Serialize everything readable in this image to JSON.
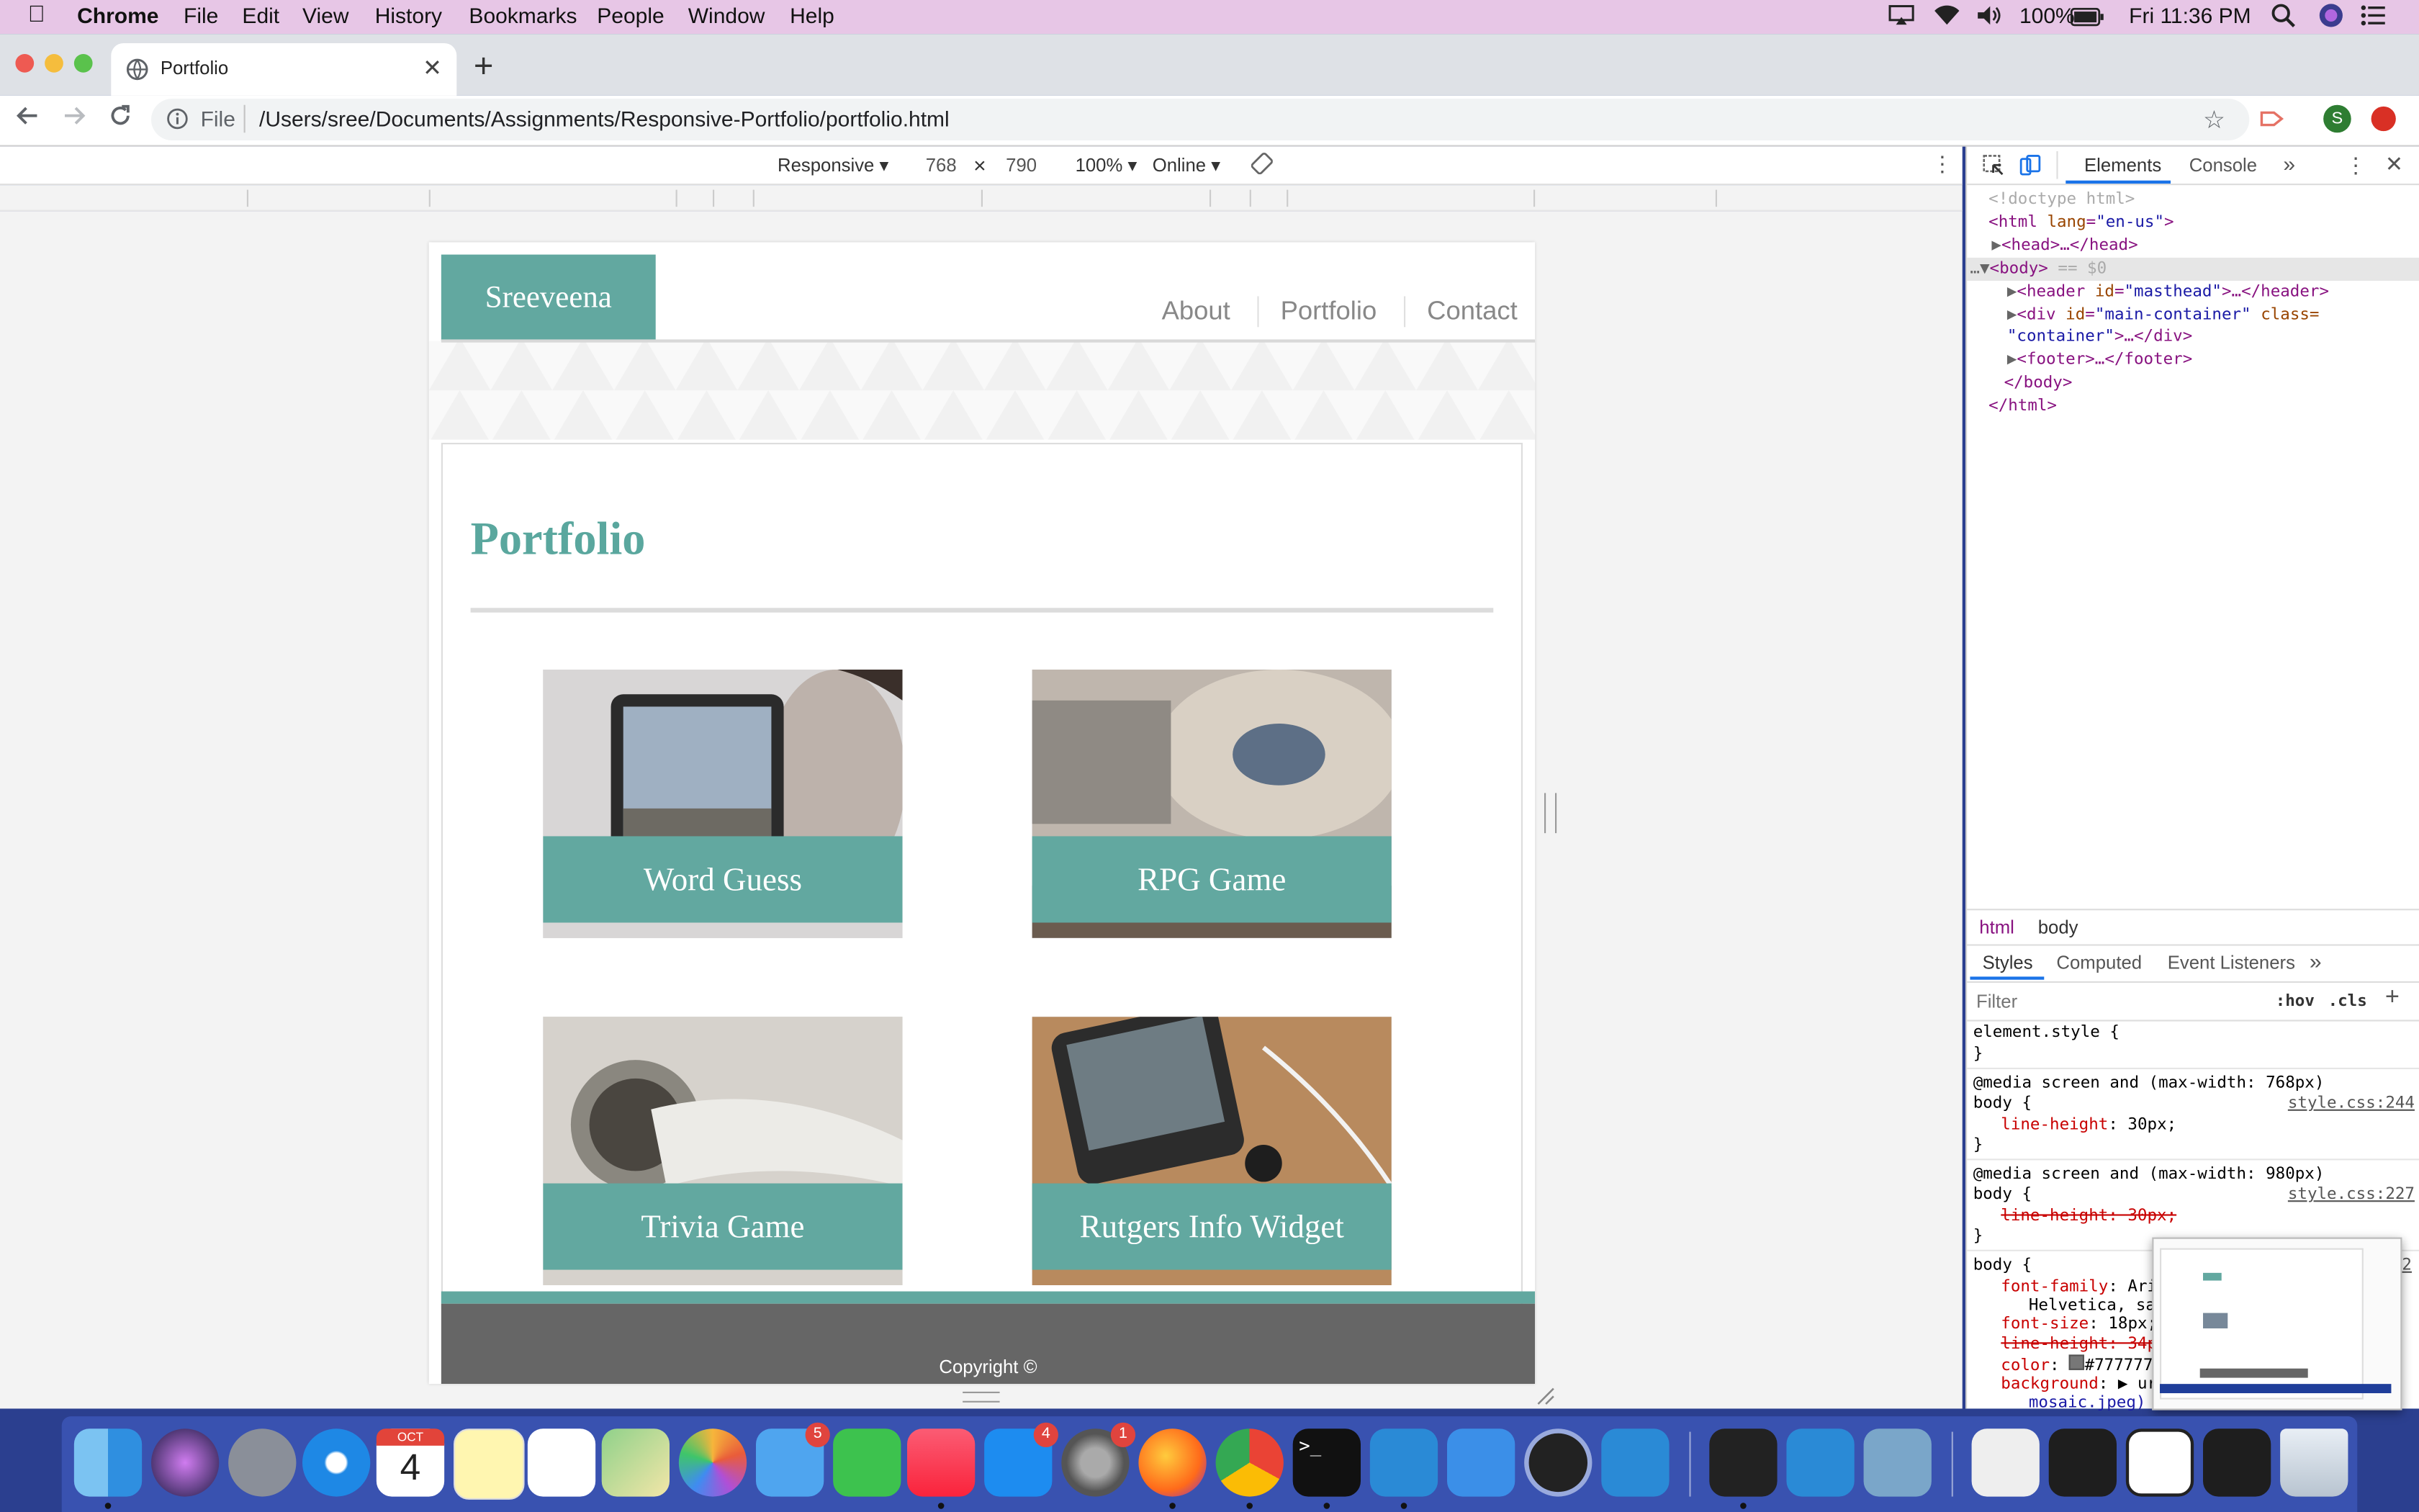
{
  "menubar": {
    "app": "Chrome",
    "items": [
      "File",
      "Edit",
      "View",
      "History",
      "Bookmarks",
      "People",
      "Window",
      "Help"
    ],
    "battery": "100%",
    "clock": "Fri 11:36 PM"
  },
  "browser": {
    "tab_title": "Portfolio",
    "url_prefix": "File",
    "url": "/Users/sree/Documents/Assignments/Responsive-Portfolio/portfolio.html",
    "profile_initial": "S"
  },
  "device_toolbar": {
    "mode": "Responsive ▾",
    "width": "768",
    "times": "×",
    "height": "790",
    "zoom": "100% ▾",
    "network": "Online ▾"
  },
  "site": {
    "brand": "Sreeveena",
    "nav": [
      "About",
      "Portfolio",
      "Contact"
    ],
    "heading": "Portfolio",
    "projects": [
      {
        "title": "Word Guess"
      },
      {
        "title": "RPG Game"
      },
      {
        "title": "Trivia Game"
      },
      {
        "title": "Rutgers Info Widget"
      }
    ],
    "footer": "Copyright ©"
  },
  "devtools": {
    "tabs": [
      "Elements",
      "Console"
    ],
    "more": "»",
    "dom": {
      "doctype": "<!doctype html>",
      "html_open_tag": "<html",
      "html_attr": "lang",
      "html_val": "\"en-us\"",
      "head": "<head>…</head>",
      "body_open": "<body>",
      "body_marker": "== $0",
      "header_tag": "<header",
      "header_attr": "id",
      "header_val": "\"masthead\"",
      "header_close": ">…</header>",
      "div_tag": "<div",
      "div_attr": "id",
      "div_val": "\"main-container\"",
      "div_class": "class=",
      "div_class_val": "\"container\"",
      "div_close": ">…</div>",
      "footer": "<footer>…</footer>",
      "body_close": "</body>",
      "html_close": "</html>"
    },
    "breadcrumbs": [
      "html",
      "body"
    ],
    "style_tabs": [
      "Styles",
      "Computed",
      "Event Listeners"
    ],
    "filter_placeholder": "Filter",
    "hov": ":hov",
    "cls": ".cls",
    "rules": {
      "element_style": "element.style {",
      "close": "}",
      "m1": "@media screen and (max-width: 768px)",
      "m1_sel": "body {",
      "m1_src": "style.css:244",
      "m1_prop": "line-height",
      "m1_val": "30px;",
      "m2": "@media screen and (max-width: 980px)",
      "m2_sel": "body {",
      "m2_src": "style.css:227",
      "m2_prop": "line-height: 30px;",
      "b_sel": "body {",
      "b_font_family": "font-family",
      "b_font_family_val": "Ari",
      "b_font_family_cont": "Helvetica, sa",
      "b_font_size": "font-size",
      "b_font_size_val": "18px;",
      "b_line_height": "line-height: 34p",
      "b_color": "color",
      "b_color_val": "#777777",
      "b_background": "background",
      "b_background_val": "url",
      "b_background_cont": "mosaic.jpeg)",
      "b_src_tail": "2"
    }
  },
  "dock": {
    "calendar_month": "OCT",
    "calendar_day": "4",
    "badges": {
      "messages": "5",
      "appstore": "4",
      "prefs": "1"
    }
  },
  "colors": {
    "teal": "#62a8a0",
    "heading_teal": "#5aa79e",
    "footer_gray": "#666666",
    "menubar": "#e7c6e6",
    "dock": "#3952b0"
  }
}
